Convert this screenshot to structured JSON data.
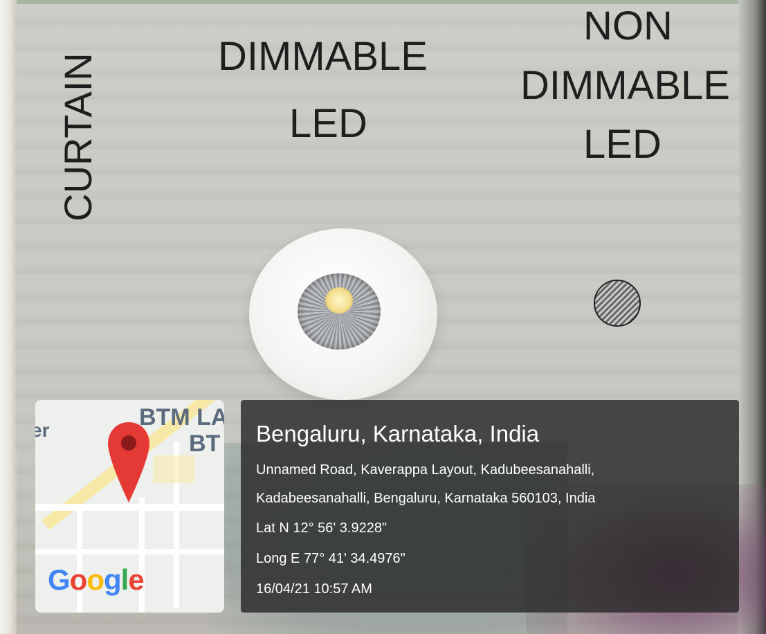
{
  "wall_labels": {
    "curtain": "CURTAIN",
    "dimmable_line1": "DIMMABLE",
    "dimmable_line2": "LED",
    "non_line1": "NON",
    "non_line2": "DIMMABLE",
    "non_line3": "LED"
  },
  "map_thumbnail": {
    "label_btm_top": "BTM LA",
    "label_btm_bottom": "BT",
    "label_left": "er",
    "logo": "Google",
    "pin_icon": "map-pin-icon",
    "logo_colors": [
      "#4285F4",
      "#EA4335",
      "#FBBC05",
      "#4285F4",
      "#34A853",
      "#EA4335"
    ]
  },
  "location": {
    "title": "Bengaluru, Karnataka, India",
    "address_line1": "Unnamed Road, Kaverappa Layout, Kadubeesanahalli,",
    "address_line2": "Kadabeesanahalli, Bengaluru, Karnataka 560103, India",
    "latitude": "Lat N 12° 56' 3.9228\"",
    "longitude": "Long E 77° 41' 34.4976\"",
    "timestamp": "16/04/21 10:57 AM"
  }
}
